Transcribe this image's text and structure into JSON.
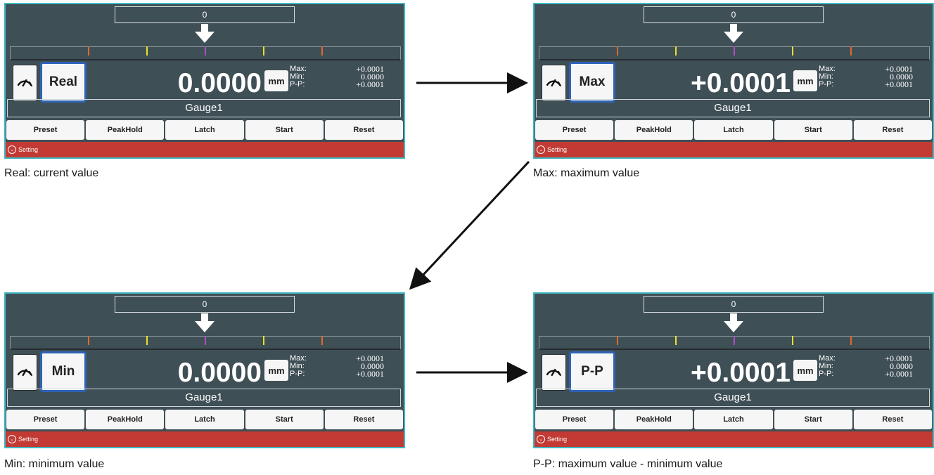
{
  "panels": [
    {
      "top_value": "0",
      "mode": "Real",
      "value": "0.0000",
      "unit": "mm",
      "stats": {
        "max_label": "Max:",
        "min_label": "Min:",
        "pp_label": "P-P:",
        "max_value": "+0.0001",
        "min_value": "0.0000",
        "pp_value": "+0.0001"
      },
      "gauge_name": "Gauge1",
      "buttons": [
        "Preset",
        "PeakHold",
        "Latch",
        "Start",
        "Reset"
      ],
      "setting_label": "Setting",
      "caption": "Real: current value"
    },
    {
      "top_value": "0",
      "mode": "Max",
      "value": "+0.0001",
      "unit": "mm",
      "stats": {
        "max_label": "Max:",
        "min_label": "Min:",
        "pp_label": "P-P:",
        "max_value": "+0.0001",
        "min_value": "0.0000",
        "pp_value": "+0.0001"
      },
      "gauge_name": "Gauge1",
      "buttons": [
        "Preset",
        "PeakHold",
        "Latch",
        "Start",
        "Reset"
      ],
      "setting_label": "Setting",
      "caption": "Max: maximum value"
    },
    {
      "top_value": "0",
      "mode": "Min",
      "value": "0.0000",
      "unit": "mm",
      "stats": {
        "max_label": "Max:",
        "min_label": "Min:",
        "pp_label": "P-P:",
        "max_value": "+0.0001",
        "min_value": "0.0000",
        "pp_value": "+0.0001"
      },
      "gauge_name": "Gauge1",
      "buttons": [
        "Preset",
        "PeakHold",
        "Latch",
        "Start",
        "Reset"
      ],
      "setting_label": "Setting",
      "caption": "Min: minimum value"
    },
    {
      "top_value": "0",
      "mode": "P-P",
      "value": "+0.0001",
      "unit": "mm",
      "stats": {
        "max_label": "Max:",
        "min_label": "Min:",
        "pp_label": "P-P:",
        "max_value": "+0.0001",
        "min_value": "0.0000",
        "pp_value": "+0.0001"
      },
      "gauge_name": "Gauge1",
      "buttons": [
        "Preset",
        "PeakHold",
        "Latch",
        "Start",
        "Reset"
      ],
      "setting_label": "Setting",
      "caption": "P-P: maximum value - minimum value"
    }
  ],
  "icons": {
    "gauge": "speedometer-icon",
    "arrow": "down-arrow-icon",
    "setting": "chevron-down-circle-icon"
  },
  "colors": {
    "panel_bg": "#3f4f56",
    "panel_border": "#3fb8c2",
    "setting_bar": "#c23a33",
    "mode_border": "#2f63b6"
  }
}
